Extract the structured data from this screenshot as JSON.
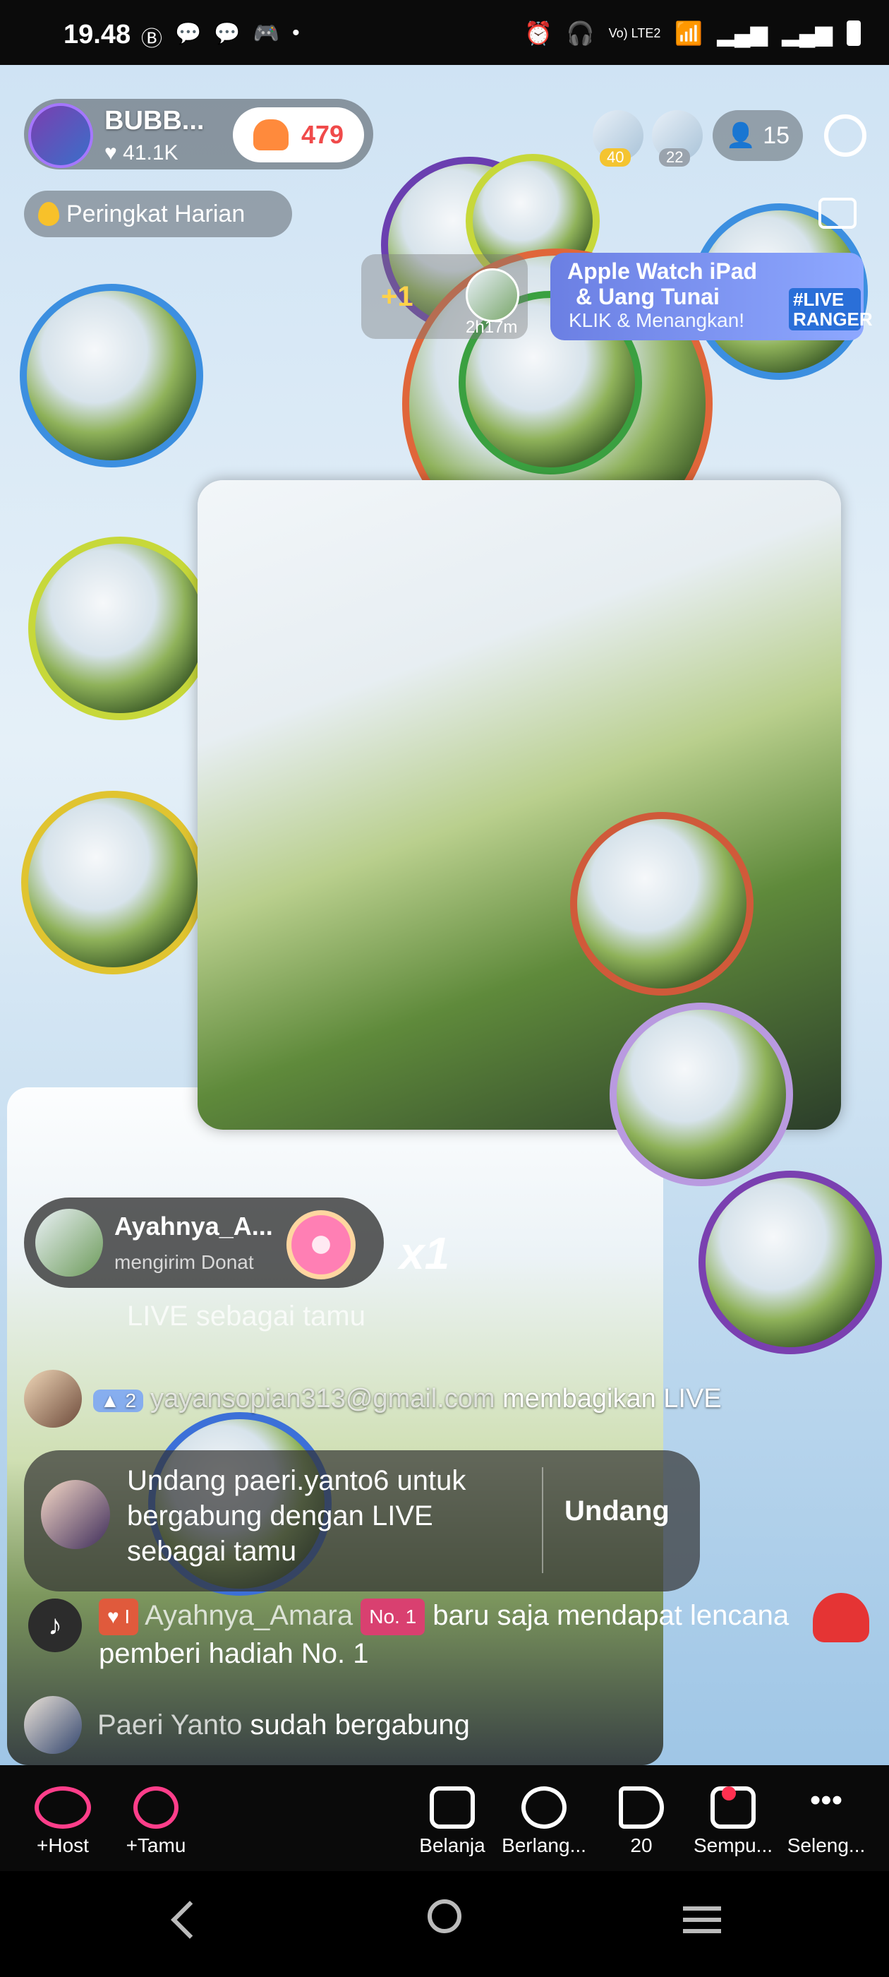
{
  "status_bar": {
    "time": "19.48",
    "left_icons": [
      "b-circle-icon",
      "chat-icon",
      "chat-icon",
      "game-icon",
      "dot-icon"
    ],
    "right_icons": [
      "alarm-icon",
      "headphones-icon",
      "volte-icon",
      "wifi-icon",
      "signal-icon",
      "signal-icon",
      "battery-icon"
    ],
    "volte_label": "Vo) LTE2"
  },
  "live_header": {
    "host_name": "BUBB...",
    "host_likes": "41.1K",
    "like_count": "479",
    "viewer_badges": [
      "40",
      "22"
    ],
    "viewer_count": "15",
    "ranking_label": "Peringkat Harian"
  },
  "gift_chip": {
    "plus": "+1",
    "timer": "2h17m"
  },
  "promo": {
    "line1": "Apple Watch iPad",
    "line2": "& Uang Tunai",
    "line3": "KLIK & Menangkan!",
    "badge": "#LIVE RANGER"
  },
  "gift_notice": {
    "name": "Ayahnya_A...",
    "action": "mengirim Donat",
    "combo": "x1"
  },
  "faded_line": "LIVE sebagai tamu",
  "comments": [
    {
      "level": "2",
      "username": "yayansopian313@gmail.com",
      "text": "membagikan LIVE"
    }
  ],
  "invite": {
    "text": "Undang paeri.yanto6 untuk bergabung dengan LIVE sebagai tamu",
    "button": "Undang"
  },
  "badge_event": {
    "fan_level": "I",
    "username": "Ayahnya_Amara",
    "rank_badge": "No. 1",
    "text": "baru saja mendapat lencana pemberi hadiah No. 1"
  },
  "joined": {
    "username": "Paeri Yanto",
    "text": "sudah bergabung"
  },
  "toolbar": {
    "host": "+Host",
    "guest": "+Tamu",
    "shop": "Belanja",
    "subscribe": "Berlang...",
    "share_count": "20",
    "magic": "Sempu...",
    "more": "Seleng..."
  },
  "colors": {
    "accent_pink": "#ff3e8a",
    "like_red": "#f04a4a",
    "heart_red": "#e53434"
  }
}
